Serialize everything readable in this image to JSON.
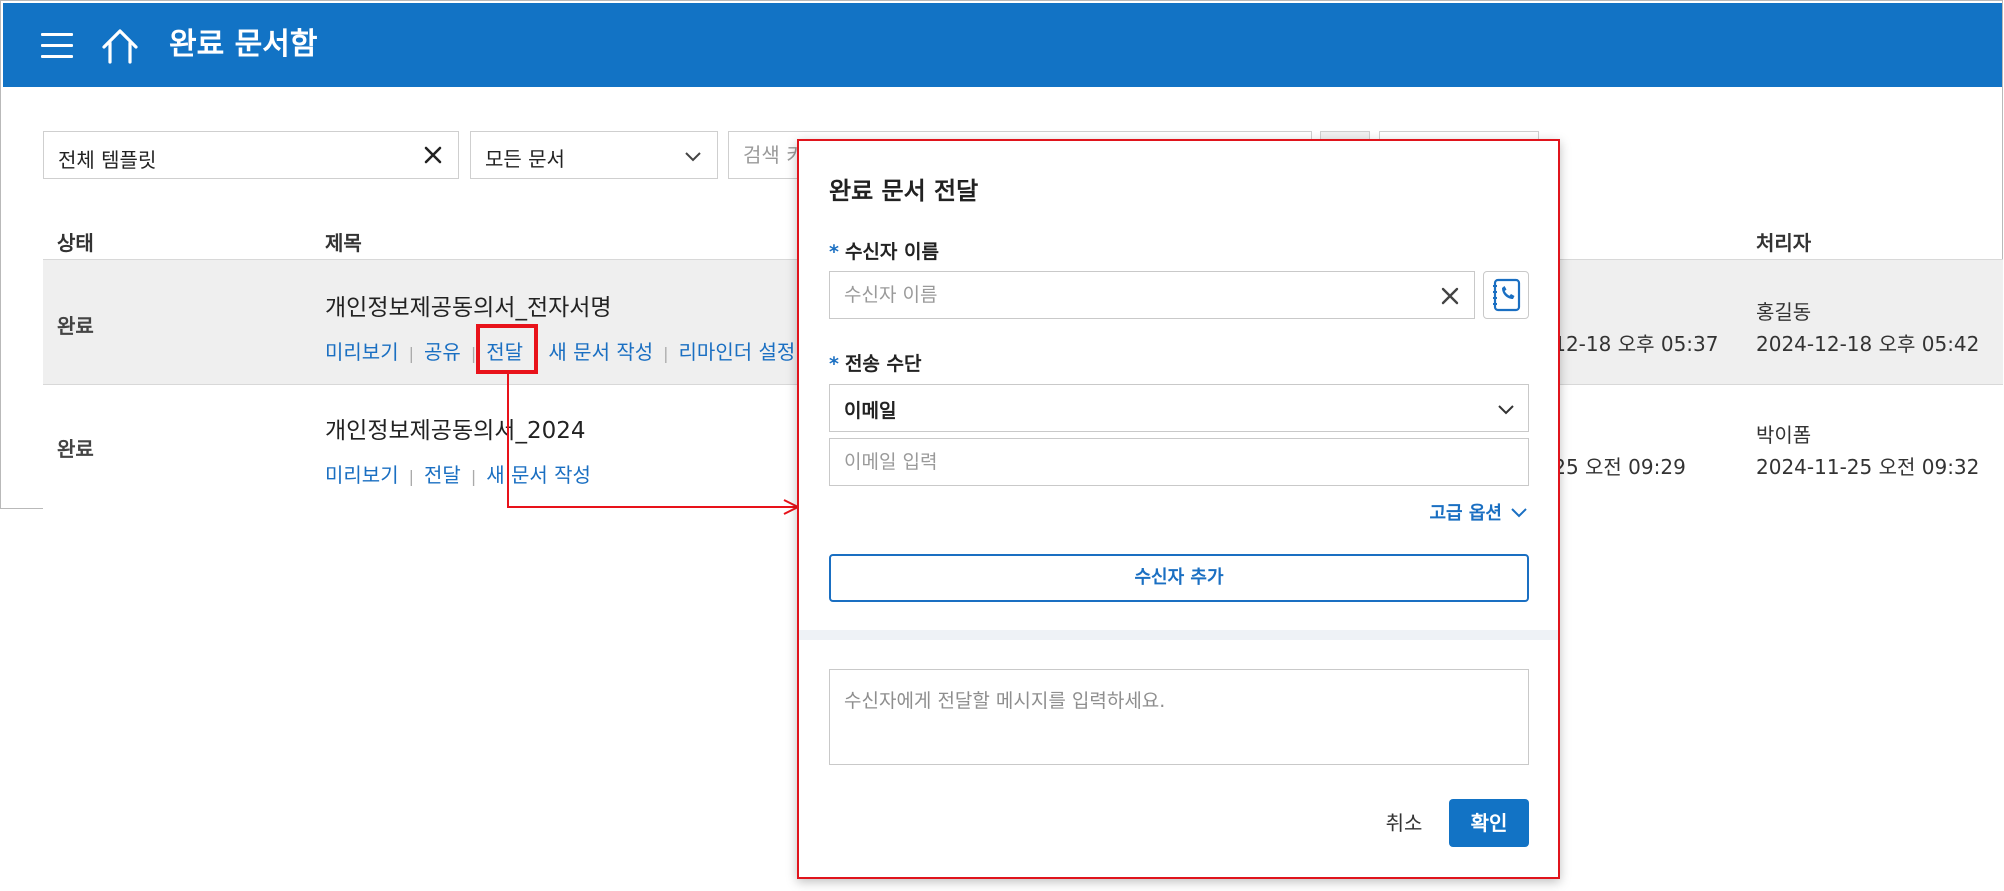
{
  "header": {
    "title": "완료 문서함",
    "menu_icon": "hamburger-menu-icon",
    "home_icon": "home-icon"
  },
  "filters": {
    "template_value": "전체 템플릿",
    "doc_filter_value": "모든 문서",
    "search_placeholder": "검색 키"
  },
  "table": {
    "columns": {
      "status": "상태",
      "title": "제목",
      "handler": "처리자"
    },
    "rows": [
      {
        "status": "완료",
        "title": "개인정보제공동의서_전자서명",
        "actions": [
          "미리보기",
          "공유",
          "전달",
          "새 문서 작성",
          "리마인더 설정"
        ],
        "date_visible": "-12-18 오후 05:37",
        "handler_name": "홍길동",
        "handler_date": "2024-12-18 오후 05:42"
      },
      {
        "status": "완료",
        "title": "개인정보제공동의서_2024",
        "actions": [
          "미리보기",
          "전달",
          "새 문서 작성"
        ],
        "date_visible": "-25 오전 09:29",
        "handler_name": "박이폼",
        "handler_date": "2024-11-25 오전 09:32"
      }
    ]
  },
  "modal": {
    "title": "완료 문서 전달",
    "required_mark": "*",
    "recipient_label": "수신자 이름",
    "recipient_placeholder": "수신자 이름",
    "method_label": "전송 수단",
    "method_value": "이메일",
    "email_placeholder": "이메일 입력",
    "advanced_options": "고급 옵션",
    "add_recipient": "수신자 추가",
    "message_placeholder": "수신자에게 전달할 메시지를 입력하세요.",
    "cancel": "취소",
    "confirm": "확인"
  },
  "colors": {
    "header_bg": "#1273c5",
    "link": "#1a6fc2",
    "annotation_red": "#e8121a"
  }
}
